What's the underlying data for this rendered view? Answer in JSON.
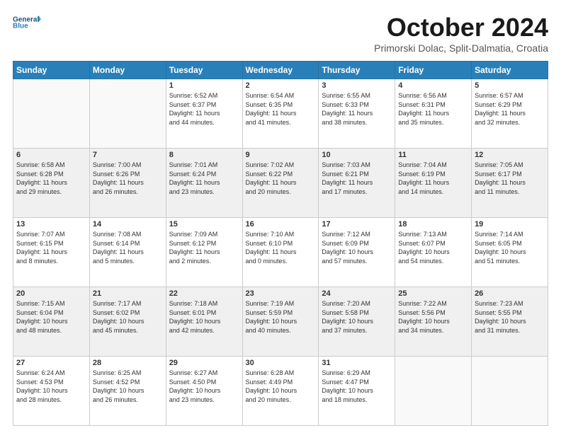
{
  "header": {
    "logo_line1": "General",
    "logo_line2": "Blue",
    "title": "October 2024",
    "location": "Primorski Dolac, Split-Dalmatia, Croatia"
  },
  "weekdays": [
    "Sunday",
    "Monday",
    "Tuesday",
    "Wednesday",
    "Thursday",
    "Friday",
    "Saturday"
  ],
  "weeks": [
    [
      {
        "day": "",
        "info": ""
      },
      {
        "day": "",
        "info": ""
      },
      {
        "day": "1",
        "info": "Sunrise: 6:52 AM\nSunset: 6:37 PM\nDaylight: 11 hours\nand 44 minutes."
      },
      {
        "day": "2",
        "info": "Sunrise: 6:54 AM\nSunset: 6:35 PM\nDaylight: 11 hours\nand 41 minutes."
      },
      {
        "day": "3",
        "info": "Sunrise: 6:55 AM\nSunset: 6:33 PM\nDaylight: 11 hours\nand 38 minutes."
      },
      {
        "day": "4",
        "info": "Sunrise: 6:56 AM\nSunset: 6:31 PM\nDaylight: 11 hours\nand 35 minutes."
      },
      {
        "day": "5",
        "info": "Sunrise: 6:57 AM\nSunset: 6:29 PM\nDaylight: 11 hours\nand 32 minutes."
      }
    ],
    [
      {
        "day": "6",
        "info": "Sunrise: 6:58 AM\nSunset: 6:28 PM\nDaylight: 11 hours\nand 29 minutes."
      },
      {
        "day": "7",
        "info": "Sunrise: 7:00 AM\nSunset: 6:26 PM\nDaylight: 11 hours\nand 26 minutes."
      },
      {
        "day": "8",
        "info": "Sunrise: 7:01 AM\nSunset: 6:24 PM\nDaylight: 11 hours\nand 23 minutes."
      },
      {
        "day": "9",
        "info": "Sunrise: 7:02 AM\nSunset: 6:22 PM\nDaylight: 11 hours\nand 20 minutes."
      },
      {
        "day": "10",
        "info": "Sunrise: 7:03 AM\nSunset: 6:21 PM\nDaylight: 11 hours\nand 17 minutes."
      },
      {
        "day": "11",
        "info": "Sunrise: 7:04 AM\nSunset: 6:19 PM\nDaylight: 11 hours\nand 14 minutes."
      },
      {
        "day": "12",
        "info": "Sunrise: 7:05 AM\nSunset: 6:17 PM\nDaylight: 11 hours\nand 11 minutes."
      }
    ],
    [
      {
        "day": "13",
        "info": "Sunrise: 7:07 AM\nSunset: 6:15 PM\nDaylight: 11 hours\nand 8 minutes."
      },
      {
        "day": "14",
        "info": "Sunrise: 7:08 AM\nSunset: 6:14 PM\nDaylight: 11 hours\nand 5 minutes."
      },
      {
        "day": "15",
        "info": "Sunrise: 7:09 AM\nSunset: 6:12 PM\nDaylight: 11 hours\nand 2 minutes."
      },
      {
        "day": "16",
        "info": "Sunrise: 7:10 AM\nSunset: 6:10 PM\nDaylight: 11 hours\nand 0 minutes."
      },
      {
        "day": "17",
        "info": "Sunrise: 7:12 AM\nSunset: 6:09 PM\nDaylight: 10 hours\nand 57 minutes."
      },
      {
        "day": "18",
        "info": "Sunrise: 7:13 AM\nSunset: 6:07 PM\nDaylight: 10 hours\nand 54 minutes."
      },
      {
        "day": "19",
        "info": "Sunrise: 7:14 AM\nSunset: 6:05 PM\nDaylight: 10 hours\nand 51 minutes."
      }
    ],
    [
      {
        "day": "20",
        "info": "Sunrise: 7:15 AM\nSunset: 6:04 PM\nDaylight: 10 hours\nand 48 minutes."
      },
      {
        "day": "21",
        "info": "Sunrise: 7:17 AM\nSunset: 6:02 PM\nDaylight: 10 hours\nand 45 minutes."
      },
      {
        "day": "22",
        "info": "Sunrise: 7:18 AM\nSunset: 6:01 PM\nDaylight: 10 hours\nand 42 minutes."
      },
      {
        "day": "23",
        "info": "Sunrise: 7:19 AM\nSunset: 5:59 PM\nDaylight: 10 hours\nand 40 minutes."
      },
      {
        "day": "24",
        "info": "Sunrise: 7:20 AM\nSunset: 5:58 PM\nDaylight: 10 hours\nand 37 minutes."
      },
      {
        "day": "25",
        "info": "Sunrise: 7:22 AM\nSunset: 5:56 PM\nDaylight: 10 hours\nand 34 minutes."
      },
      {
        "day": "26",
        "info": "Sunrise: 7:23 AM\nSunset: 5:55 PM\nDaylight: 10 hours\nand 31 minutes."
      }
    ],
    [
      {
        "day": "27",
        "info": "Sunrise: 6:24 AM\nSunset: 4:53 PM\nDaylight: 10 hours\nand 28 minutes."
      },
      {
        "day": "28",
        "info": "Sunrise: 6:25 AM\nSunset: 4:52 PM\nDaylight: 10 hours\nand 26 minutes."
      },
      {
        "day": "29",
        "info": "Sunrise: 6:27 AM\nSunset: 4:50 PM\nDaylight: 10 hours\nand 23 minutes."
      },
      {
        "day": "30",
        "info": "Sunrise: 6:28 AM\nSunset: 4:49 PM\nDaylight: 10 hours\nand 20 minutes."
      },
      {
        "day": "31",
        "info": "Sunrise: 6:29 AM\nSunset: 4:47 PM\nDaylight: 10 hours\nand 18 minutes."
      },
      {
        "day": "",
        "info": ""
      },
      {
        "day": "",
        "info": ""
      }
    ]
  ]
}
